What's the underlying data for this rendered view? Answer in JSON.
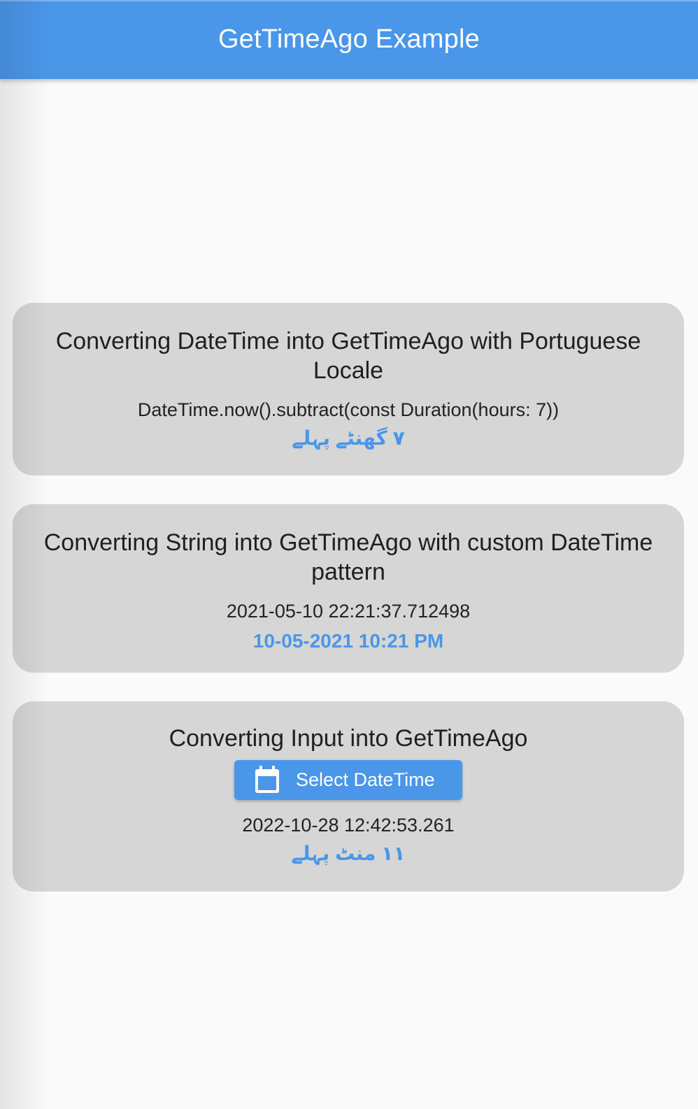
{
  "app_bar": {
    "title": "GetTimeAgo Example"
  },
  "cards": [
    {
      "title": "Converting DateTime into GetTimeAgo with Portuguese Locale",
      "input": "DateTime.now().subtract(const Duration(hours: 7))",
      "result": "۷ گھنٹے پہلے"
    },
    {
      "title": "Converting String into GetTimeAgo with custom DateTime pattern",
      "input": "2021-05-10 22:21:37.712498",
      "result": "10-05-2021 10:21 PM"
    },
    {
      "title": "Converting Input into GetTimeAgo",
      "button_label": "Select DateTime",
      "button_icon": "calendar-icon",
      "input": "2022-10-28 12:42:53.261",
      "result": "۱۱ منٹ پہلے"
    }
  ],
  "colors": {
    "primary": "#4a96e9",
    "card_background": "#d6d6d6",
    "page_background": "#fafafa"
  }
}
